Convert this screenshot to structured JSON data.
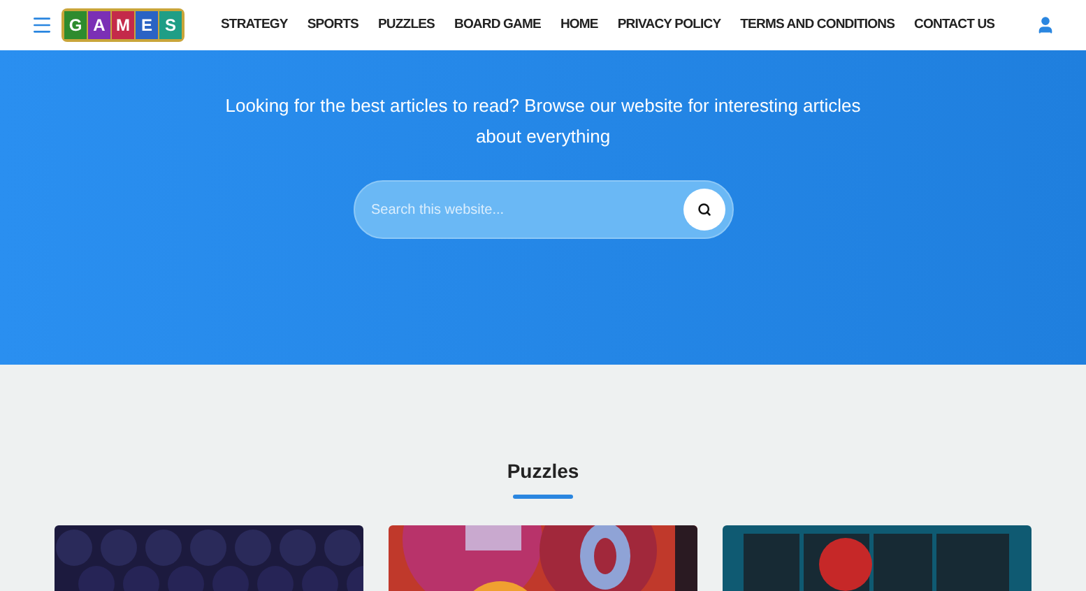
{
  "header": {
    "logo": [
      {
        "letter": "G",
        "color": "#2e8b2e"
      },
      {
        "letter": "A",
        "color": "#7b2fb5"
      },
      {
        "letter": "M",
        "color": "#c42a4a"
      },
      {
        "letter": "E",
        "color": "#2a63c4"
      },
      {
        "letter": "S",
        "color": "#1f9e86"
      }
    ],
    "nav": [
      "STRATEGY",
      "SPORTS",
      "PUZZLES",
      "BOARD GAME",
      "HOME",
      "PRIVACY POLICY",
      "TERMS AND CONDITIONS",
      "CONTACT US"
    ]
  },
  "hero": {
    "tagline": "Looking for the best articles to read? Browse our website for interesting articles about everything",
    "search": {
      "placeholder": "Search this website..."
    }
  },
  "section": {
    "title": "Puzzles"
  }
}
